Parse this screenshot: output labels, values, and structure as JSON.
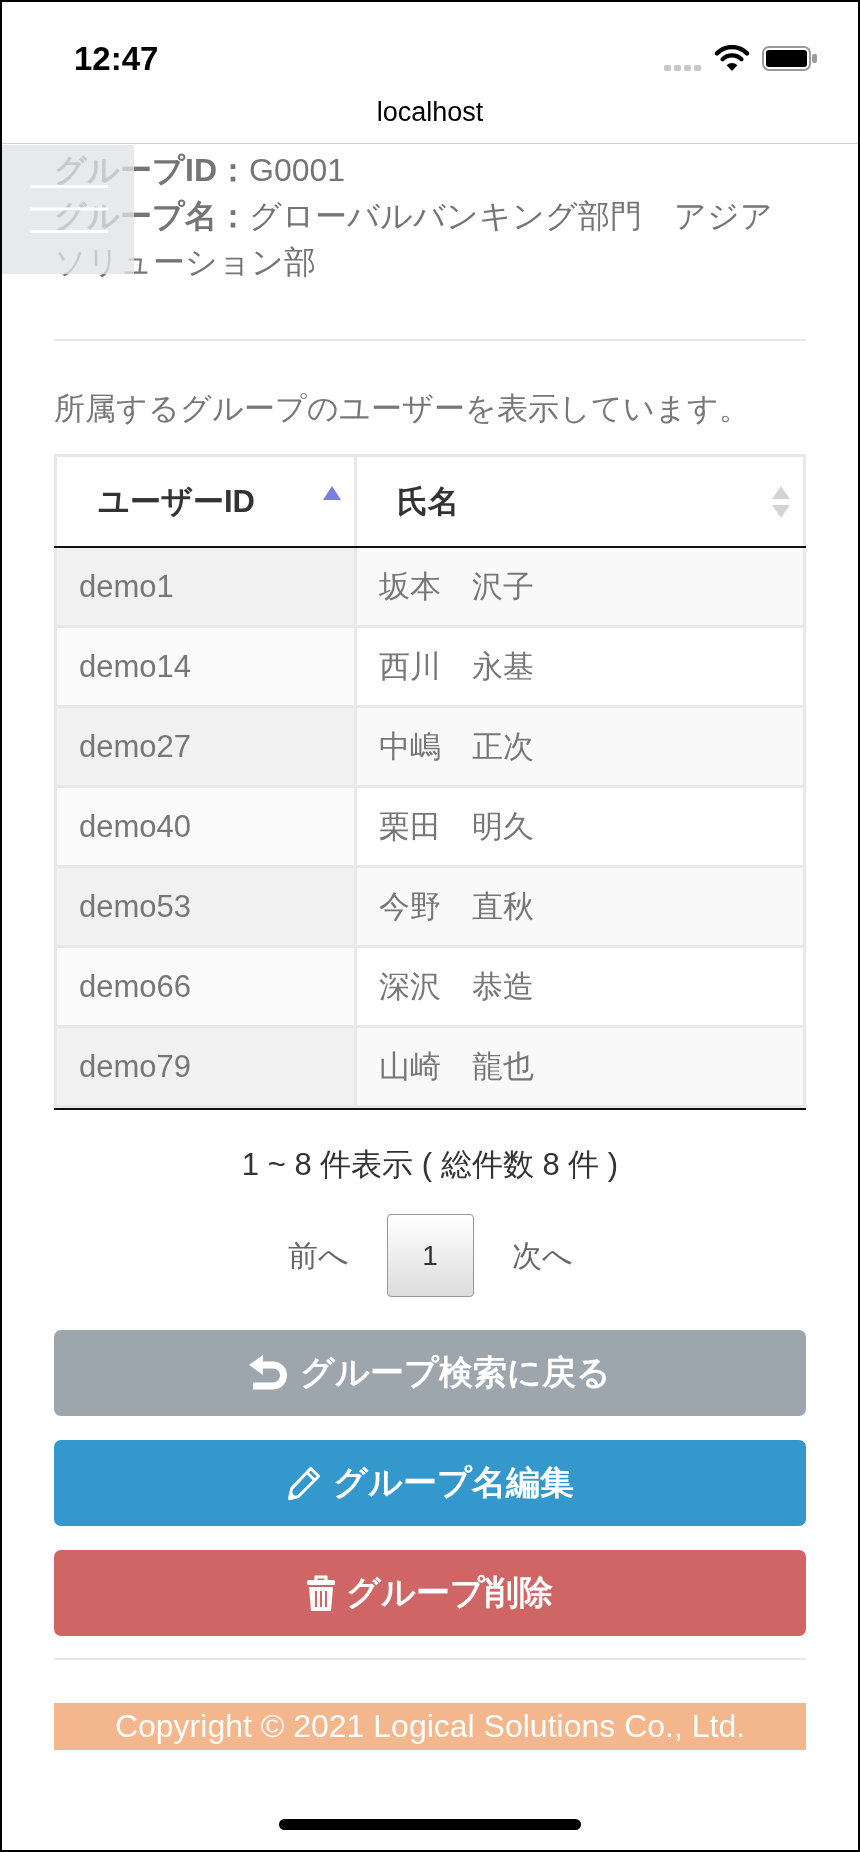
{
  "status_bar": {
    "time": "12:47"
  },
  "browser": {
    "address": "localhost"
  },
  "group": {
    "fields": [
      {
        "label": "グループID：",
        "value": "G0001"
      },
      {
        "label": "グループ名：",
        "value": "グローバルバンキング部門　アジアソリューション部"
      }
    ]
  },
  "description": "所属するグループのユーザーを表示しています。",
  "table": {
    "columns": [
      {
        "label": "ユーザーID",
        "sorted": true
      },
      {
        "label": "氏名",
        "sorted": false
      }
    ],
    "rows": [
      [
        "demo1",
        "坂本　沢子"
      ],
      [
        "demo14",
        "西川　永基"
      ],
      [
        "demo27",
        "中嶋　正次"
      ],
      [
        "demo40",
        "栗田　明久"
      ],
      [
        "demo53",
        "今野　直秋"
      ],
      [
        "demo66",
        "深沢　恭造"
      ],
      [
        "demo79",
        "山崎　龍也"
      ]
    ]
  },
  "pagination": {
    "info": "1 ~ 8 件表示 ( 総件数 8 件 )",
    "previous": {
      "label": "前へ",
      "disabled": true
    },
    "pages": [
      {
        "label": "1",
        "selected": true
      }
    ],
    "next": {
      "label": "次へ",
      "disabled": true
    }
  },
  "buttons": [
    {
      "kind": "back",
      "label": "グループ検索に戻る"
    },
    {
      "kind": "edit",
      "label": "グループ名編集"
    },
    {
      "kind": "delete",
      "label": "グループ削除"
    }
  ],
  "footer": {
    "text": "Copyright © 2021 Logical Solutions Co., Ltd."
  }
}
